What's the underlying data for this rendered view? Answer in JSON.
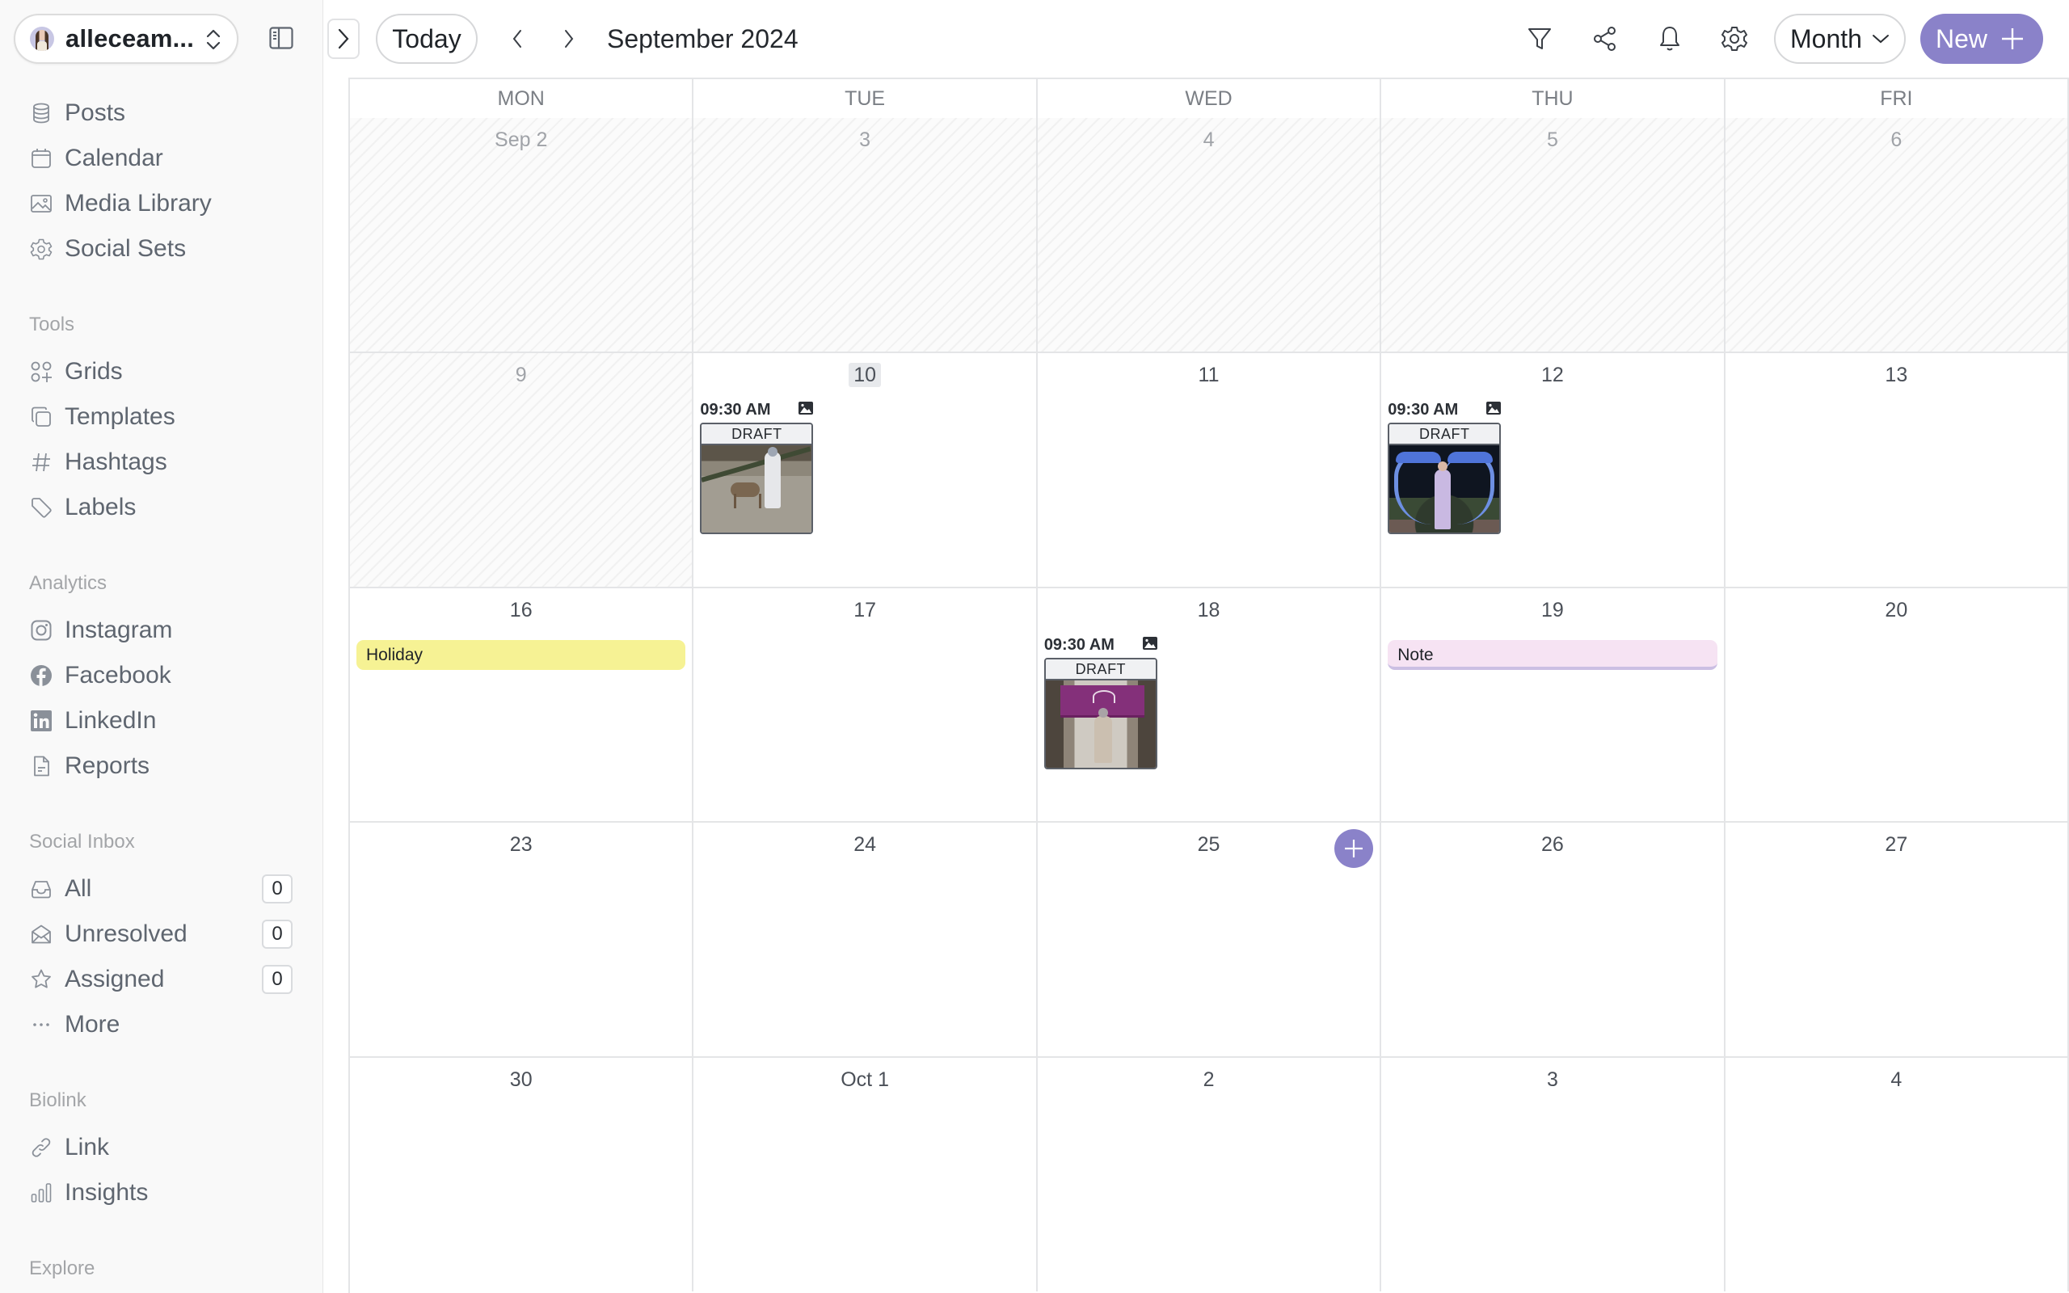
{
  "account": {
    "name": "alleceam..."
  },
  "sidebar": {
    "main": [
      {
        "label": "Posts",
        "icon": "database-icon"
      },
      {
        "label": "Calendar",
        "icon": "calendar-icon"
      },
      {
        "label": "Media Library",
        "icon": "image-icon"
      },
      {
        "label": "Social Sets",
        "icon": "gear-icon"
      }
    ],
    "tools": {
      "title": "Tools",
      "items": [
        {
          "label": "Grids",
          "icon": "grid-plus-icon"
        },
        {
          "label": "Templates",
          "icon": "copy-icon"
        },
        {
          "label": "Hashtags",
          "icon": "hashtag-icon"
        },
        {
          "label": "Labels",
          "icon": "tag-icon"
        }
      ]
    },
    "analytics": {
      "title": "Analytics",
      "items": [
        {
          "label": "Instagram",
          "icon": "instagram-icon"
        },
        {
          "label": "Facebook",
          "icon": "facebook-icon"
        },
        {
          "label": "LinkedIn",
          "icon": "linkedin-icon"
        },
        {
          "label": "Reports",
          "icon": "document-icon"
        }
      ]
    },
    "inbox": {
      "title": "Social Inbox",
      "items": [
        {
          "label": "All",
          "icon": "inbox-icon",
          "count": "0"
        },
        {
          "label": "Unresolved",
          "icon": "envelope-open-icon",
          "count": "0"
        },
        {
          "label": "Assigned",
          "icon": "star-icon",
          "count": "0"
        },
        {
          "label": "More",
          "icon": "ellipsis-icon"
        }
      ]
    },
    "biolink": {
      "title": "Biolink",
      "items": [
        {
          "label": "Link",
          "icon": "link-icon"
        },
        {
          "label": "Insights",
          "icon": "bar-chart-icon"
        }
      ]
    },
    "explore": {
      "title": "Explore"
    }
  },
  "toolbar": {
    "today_label": "Today",
    "month_title": "September 2024",
    "view_select": "Month",
    "new_label": "New",
    "colors": {
      "accent": "#8a82c9"
    }
  },
  "calendar": {
    "weekdays": [
      "MON",
      "TUE",
      "WED",
      "THU",
      "FRI"
    ],
    "weeks": [
      {
        "days": [
          {
            "label": "Sep 2",
            "past": true
          },
          {
            "label": "3",
            "past": true
          },
          {
            "label": "4",
            "past": true
          },
          {
            "label": "5",
            "past": true
          },
          {
            "label": "6",
            "past": true
          }
        ]
      },
      {
        "days": [
          {
            "label": "9",
            "past": true
          },
          {
            "label": "10",
            "today": true
          },
          {
            "label": "11"
          },
          {
            "label": "12"
          },
          {
            "label": "13"
          }
        ]
      },
      {
        "days": [
          {
            "label": "16"
          },
          {
            "label": "17"
          },
          {
            "label": "18"
          },
          {
            "label": "19"
          },
          {
            "label": "20"
          }
        ]
      },
      {
        "days": [
          {
            "label": "23"
          },
          {
            "label": "24"
          },
          {
            "label": "25"
          },
          {
            "label": "26"
          },
          {
            "label": "27"
          }
        ]
      },
      {
        "days": [
          {
            "label": "30"
          },
          {
            "label": "Oct 1"
          },
          {
            "label": "2"
          },
          {
            "label": "3"
          },
          {
            "label": "4"
          }
        ]
      }
    ],
    "posts": [
      {
        "day": "10",
        "time": "09:30 AM",
        "status": "DRAFT",
        "media": "image-icon",
        "thumb": "deer"
      },
      {
        "day": "12",
        "time": "09:30 AM",
        "status": "DRAFT",
        "media": "image-icon",
        "thumb": "heart"
      },
      {
        "day": "18",
        "time": "09:30 AM",
        "status": "DRAFT",
        "media": "image-icon",
        "thumb": "temple"
      }
    ],
    "events": [
      {
        "day": "16",
        "label": "Holiday",
        "type": "holiday",
        "color": "#f6f294"
      },
      {
        "day": "19",
        "label": "Note",
        "type": "note",
        "color": "#f6e3f3"
      }
    ],
    "hover_add_day": "25"
  }
}
